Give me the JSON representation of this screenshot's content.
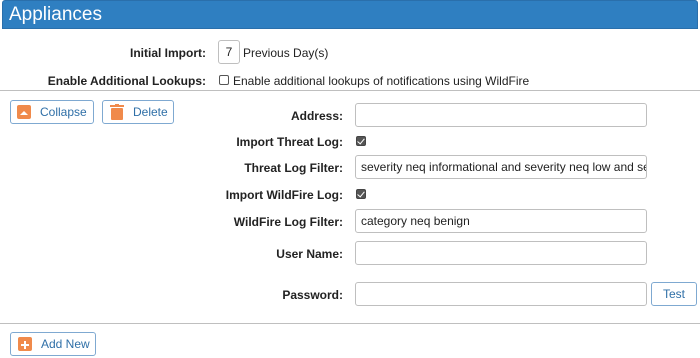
{
  "header": {
    "title": "Appliances"
  },
  "initial_import": {
    "label": "Initial Import:",
    "value": "7",
    "suffix": "Previous Day(s)"
  },
  "additional_lookups": {
    "label": "Enable Additional Lookups:",
    "checked": false,
    "checkbox_label": "Enable additional lookups of notifications using WildFire"
  },
  "appliance": {
    "collapse_label": "Collapse",
    "delete_label": "Delete",
    "address": {
      "label": "Address:",
      "value": ""
    },
    "import_threat_log": {
      "label": "Import Threat Log:",
      "checked": true
    },
    "threat_log_filter": {
      "label": "Threat Log Filter:",
      "value": "severity neq informational and severity neq low and se"
    },
    "import_wildfire_log": {
      "label": "Import WildFire Log:",
      "checked": true
    },
    "wildfire_log_filter": {
      "label": "WildFire Log Filter:",
      "value": "category neq benign"
    },
    "user_name": {
      "label": "User Name:",
      "value": ""
    },
    "password": {
      "label": "Password:",
      "value": ""
    },
    "test_label": "Test"
  },
  "add_new_label": "Add New",
  "icons": {
    "collapse": "collapse-up-icon",
    "delete": "trash-icon",
    "add": "plus-icon"
  },
  "colors": {
    "header_bg": "#2f7fc1",
    "accent_icon": "#f08a4b",
    "button_text": "#2f6fa7"
  }
}
